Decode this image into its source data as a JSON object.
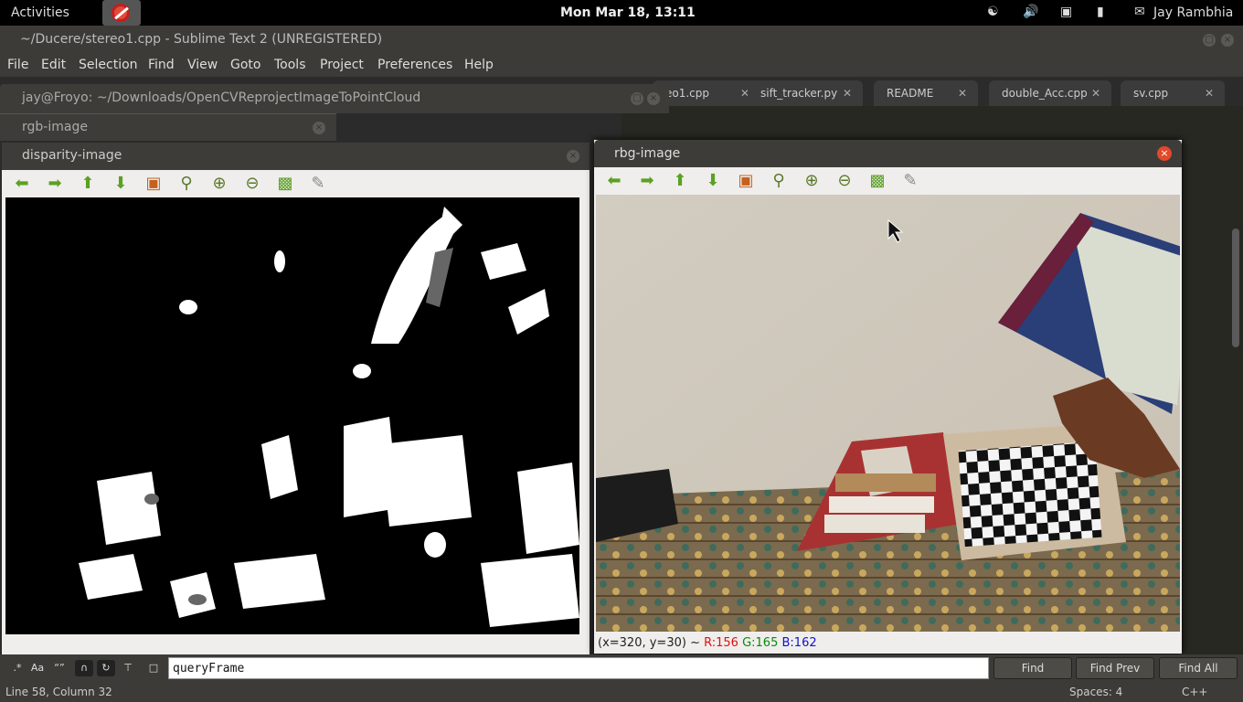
{
  "topbar": {
    "activities": "Activities",
    "clock": "Mon Mar 18, 13:11",
    "user": "Jay Rambhia"
  },
  "sublime": {
    "title": "~/Ducere/stereo1.cpp - Sublime Text 2 (UNREGISTERED)",
    "menu": [
      "File",
      "Edit",
      "Selection",
      "Find",
      "View",
      "Goto",
      "Tools",
      "Project",
      "Preferences",
      "Help"
    ],
    "tabs": [
      "eo1.cpp",
      "sift_tracker.py",
      "README",
      "double_Acc.cpp",
      "sv.cpp"
    ]
  },
  "terminal": {
    "title": "jay@Froyo: ~/Downloads/OpenCVReprojectImageToPointCloud"
  },
  "rgb_window": {
    "title": "rgb-image"
  },
  "disparity_window": {
    "title": "disparity-image"
  },
  "rbg_window": {
    "title": "rbg-image",
    "status": {
      "coords": "(x=320, y=30) ~",
      "r": "R:156",
      "g": "G:165",
      "b": "B:162"
    }
  },
  "findbar": {
    "query": "queryFrame",
    "buttons": [
      "Find",
      "Find Prev",
      "Find All"
    ],
    "option_labels": {
      "case": "Aa",
      "word": "“”"
    }
  },
  "statusbar": {
    "position": "Line 58, Column 32",
    "spaces": "Spaces: 4",
    "syntax": "C++"
  },
  "colors": {
    "status_r": "#e01010",
    "status_g": "#0a8a0a",
    "status_b": "#1010d0",
    "close_red": "#e2492b",
    "toolbar_green": "#5aa122"
  },
  "toolbar_icons": [
    "arrow-left-icon",
    "arrow-right-icon",
    "arrow-up-icon",
    "arrow-down-icon",
    "image-icon",
    "zoom-fit-icon",
    "zoom-in-icon",
    "zoom-out-icon",
    "save-icon",
    "brush-icon"
  ]
}
